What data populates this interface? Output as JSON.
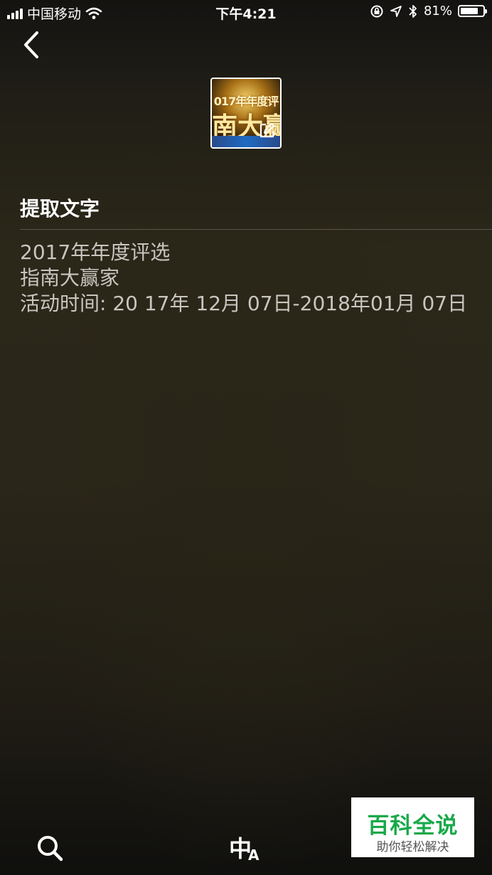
{
  "status_bar": {
    "carrier": "中国移动",
    "time": "下午4:21",
    "battery_percent": "81%",
    "battery_level": 0.81
  },
  "thumbnail": {
    "line1": "017年年度评",
    "line2": "南大赢"
  },
  "section_title": "提取文字",
  "extracted_text": {
    "line1": "2017年年度评选",
    "line2": "指南大赢家",
    "line3": "活动时间: 20 17年 12月 07日-2018年01月 07日"
  },
  "toolbar": {
    "translate_main": "中",
    "translate_sub": "A"
  },
  "watermark": {
    "title": "百科全说",
    "subtitle": "助你轻松解决"
  },
  "icons": [
    "signal-icon",
    "wifi-icon",
    "orientation-lock-icon",
    "location-icon",
    "bluetooth-icon",
    "battery-icon",
    "back-chevron-icon",
    "edit-icon",
    "search-icon",
    "translate-icon"
  ]
}
